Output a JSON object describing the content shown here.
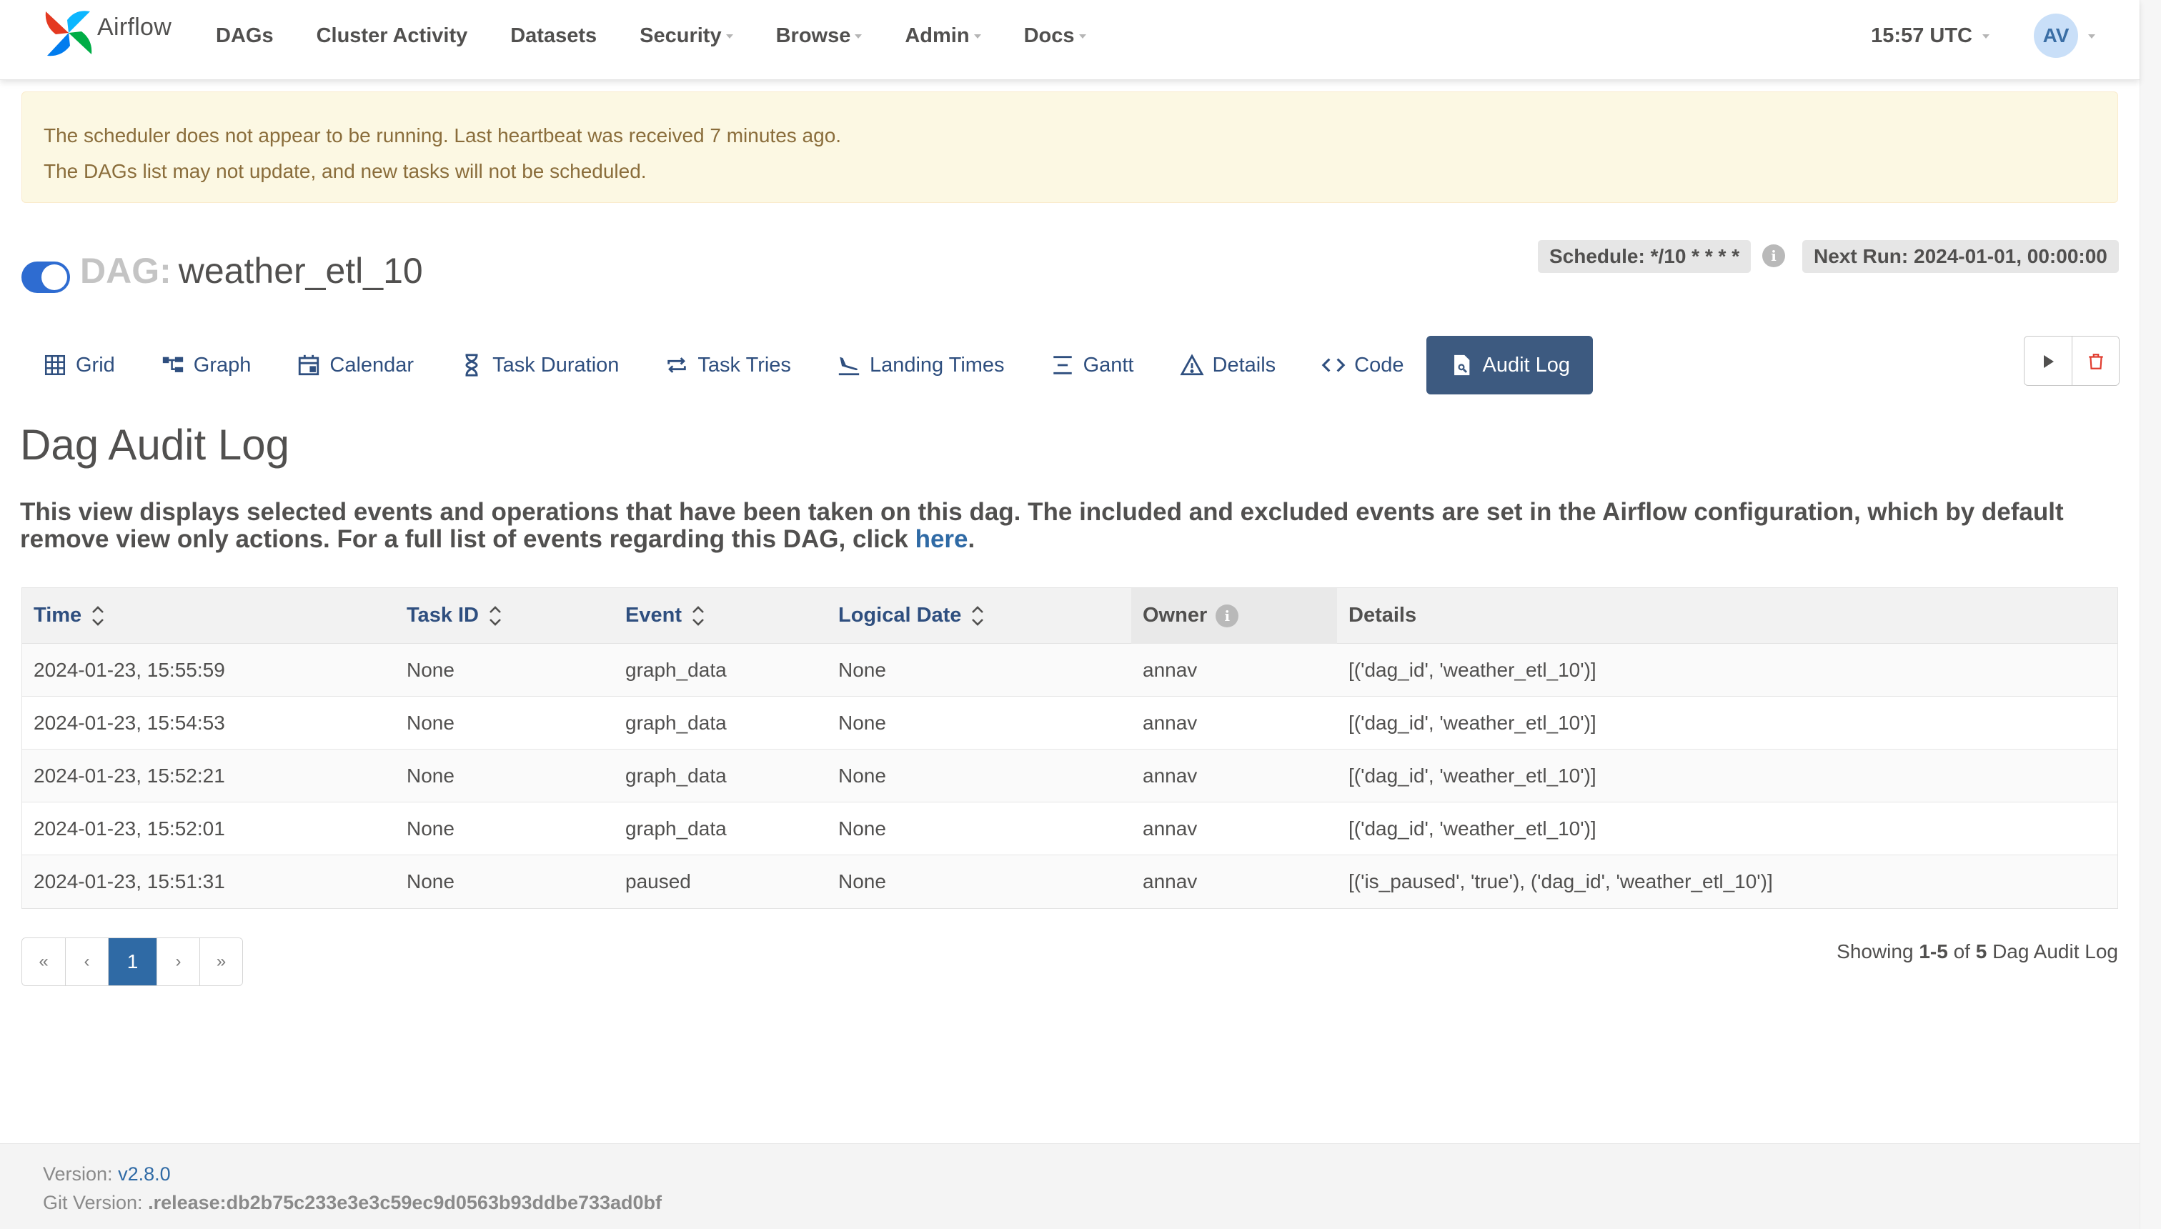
{
  "nav": {
    "logo_text": "Airflow",
    "items": [
      "DAGs",
      "Cluster Activity",
      "Datasets",
      "Security",
      "Browse",
      "Admin",
      "Docs"
    ],
    "time": "15:57 UTC",
    "avatar": "AV"
  },
  "alert": {
    "line1": "The scheduler does not appear to be running. Last heartbeat was received 7 minutes ago.",
    "line2": "The DAGs list may not update, and new tasks will not be scheduled."
  },
  "dag": {
    "label": "DAG:",
    "id": "weather_etl_10",
    "paused": false,
    "schedule": "Schedule: */10 * * * *",
    "next_run": "Next Run: 2024-01-01, 00:00:00"
  },
  "tabs": [
    "Grid",
    "Graph",
    "Calendar",
    "Task Duration",
    "Task Tries",
    "Landing Times",
    "Gantt",
    "Details",
    "Code",
    "Audit Log"
  ],
  "active_tab": "Audit Log",
  "page": {
    "title": "Dag Audit Log",
    "description": "This view displays selected events and operations that have been taken on this dag. The included and excluded events are set in the Airflow configuration, which by default remove view only actions. For a full list of events regarding this DAG, click ",
    "link_text": "here",
    "description_end": "."
  },
  "table": {
    "columns": [
      "Time",
      "Task ID",
      "Event",
      "Logical Date",
      "Owner",
      "Details"
    ],
    "rows": [
      [
        "2024-01-23, 15:55:59",
        "None",
        "graph_data",
        "None",
        "annav",
        "[('dag_id', 'weather_etl_10')]"
      ],
      [
        "2024-01-23, 15:54:53",
        "None",
        "graph_data",
        "None",
        "annav",
        "[('dag_id', 'weather_etl_10')]"
      ],
      [
        "2024-01-23, 15:52:21",
        "None",
        "graph_data",
        "None",
        "annav",
        "[('dag_id', 'weather_etl_10')]"
      ],
      [
        "2024-01-23, 15:52:01",
        "None",
        "graph_data",
        "None",
        "annav",
        "[('dag_id', 'weather_etl_10')]"
      ],
      [
        "2024-01-23, 15:51:31",
        "None",
        "paused",
        "None",
        "annav",
        "[('is_paused', 'true'), ('dag_id', 'weather_etl_10')]"
      ]
    ]
  },
  "pagination": {
    "first": "«",
    "prev": "‹",
    "current": "1",
    "next": "›",
    "last": "»",
    "showing_prefix": "Showing ",
    "range": "1-5",
    "of": " of ",
    "total": "5",
    "suffix": " Dag Audit Log"
  },
  "footer": {
    "version_label": "Version: ",
    "version": "v2.8.0",
    "git_label": "Git Version: ",
    "git": ".release:db2b75c233e3e3c59ec9d0563b93ddbe733ad0bf"
  },
  "colors": {
    "accent": "#3d5a80",
    "link": "#2f6aa5",
    "alert_bg": "#fcf8e3",
    "toggle": "#2e6cd1"
  }
}
